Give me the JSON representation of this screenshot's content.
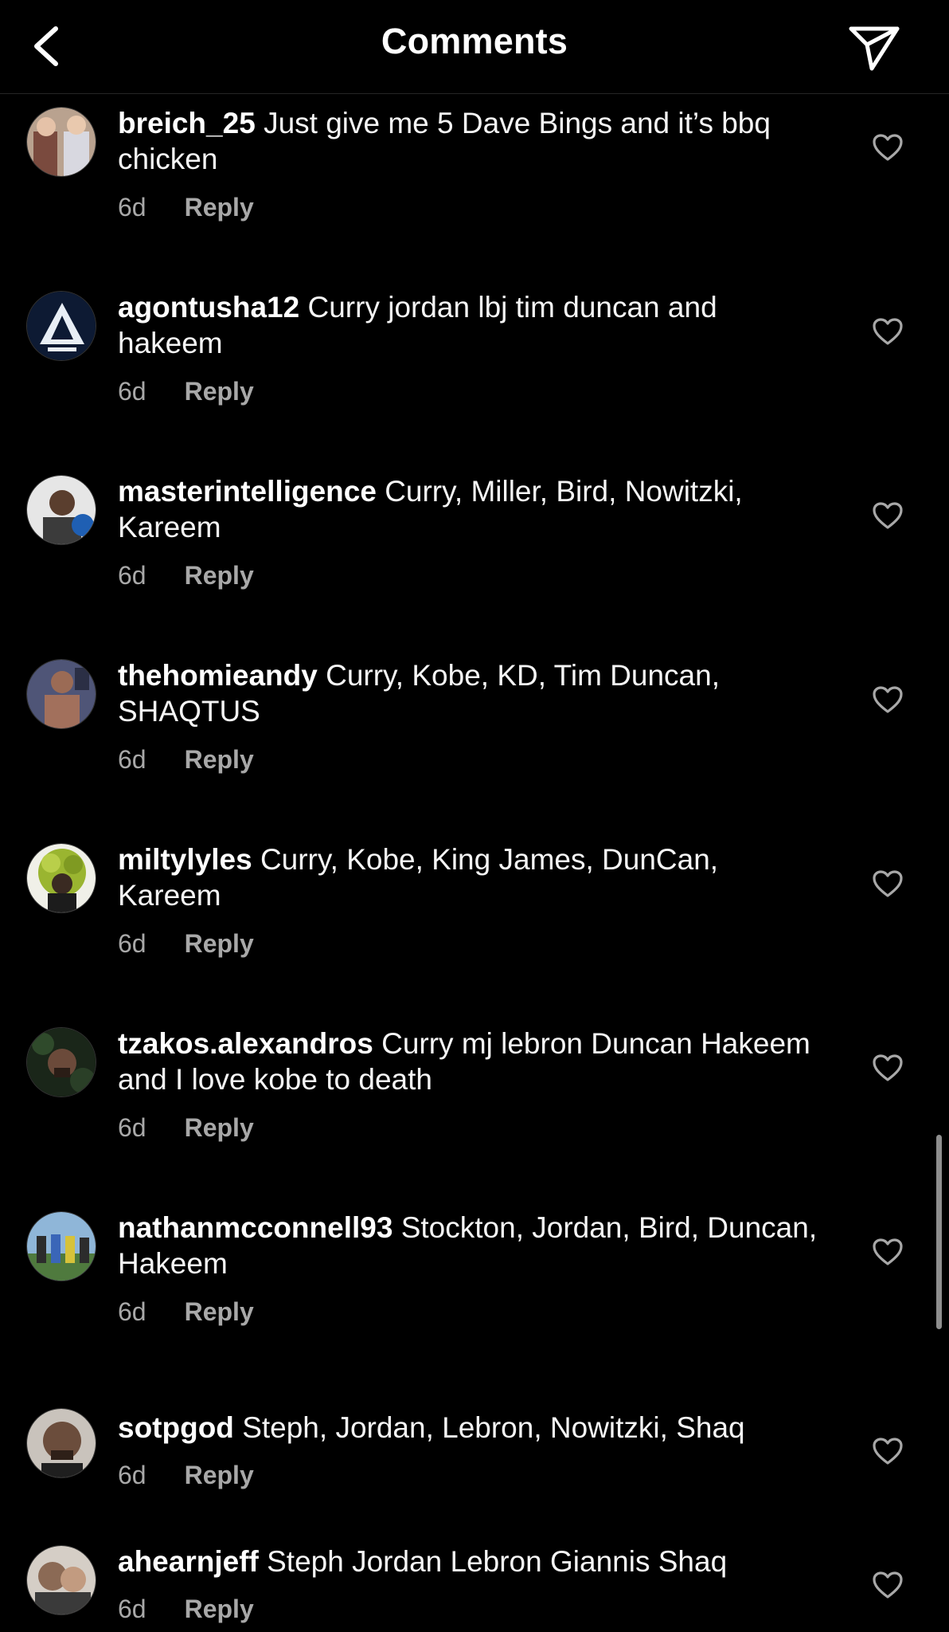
{
  "header": {
    "title": "Comments"
  },
  "comments": [
    {
      "username": "breich_25",
      "text": "Just give me 5 Dave Bings and it’s bbq chicken",
      "time": "6d",
      "reply": "Reply",
      "avatar_color": "#9a7b6a"
    },
    {
      "username": "agontusha12",
      "text": "Curry jordan lbj tim duncan and hakeem",
      "time": "6d",
      "reply": "Reply",
      "avatar_color": "#0d1a33"
    },
    {
      "username": "masterintelligence",
      "text": "Curry, Miller, Bird, Nowitzki, Kareem",
      "time": "6d",
      "reply": "Reply",
      "avatar_color": "#5d7fa0"
    },
    {
      "username": "thehomieandy",
      "text": "Curry, Kobe, KD, Tim Duncan, SHAQTUS",
      "time": "6d",
      "reply": "Reply",
      "avatar_color": "#6a4c48"
    },
    {
      "username": "miltylyles",
      "text": "Curry, Kobe, King James, DunCan, Kareem",
      "time": "6d",
      "reply": "Reply",
      "avatar_color": "#8fa632"
    },
    {
      "username": "tzakos.alexandros",
      "text": "Curry mj lebron Duncan Hakeem and I love kobe to death",
      "time": "6d",
      "reply": "Reply",
      "avatar_color": "#223122"
    },
    {
      "username": "nathanmcconnell93",
      "text": "Stockton, Jordan, Bird, Duncan, Hakeem",
      "time": "6d",
      "reply": "Reply",
      "avatar_color": "#4e7a45"
    },
    {
      "username": "sotpgod",
      "text": "Steph, Jordan, Lebron, Nowitzki, Shaq",
      "time": "6d",
      "reply": "Reply",
      "avatar_color": "#6b5647"
    },
    {
      "username": "ahearnjeff",
      "text": "Steph Jordan Lebron Giannis Shaq",
      "time": "6d",
      "reply": "Reply",
      "avatar_color": "#5c5650"
    }
  ]
}
